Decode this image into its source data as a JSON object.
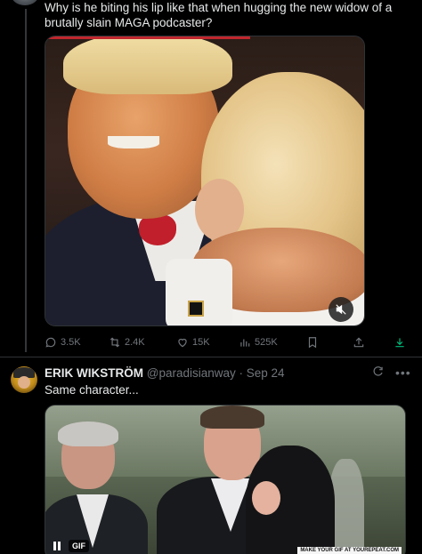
{
  "tweet1": {
    "text": "Why is he biting his lip like that when hugging the new widow of a brutally slain MAGA podcaster?",
    "media_icon": "mute-icon",
    "actions": {
      "replies": "3.5K",
      "retweets": "2.4K",
      "likes": "15K",
      "views": "525K"
    }
  },
  "tweet2": {
    "name": "ERIK WIKSTRÖM",
    "handle": "@paradisianway",
    "sep": " · ",
    "date": "Sep 24",
    "text": "Same character...",
    "gif_label": "GIF",
    "watermark": "MAKE YOUR GIF AT YOUREPEAT.COM"
  },
  "colors": {
    "background": "#000000",
    "text": "#e7e9ea",
    "muted": "#71767b",
    "border": "#2f3336"
  }
}
